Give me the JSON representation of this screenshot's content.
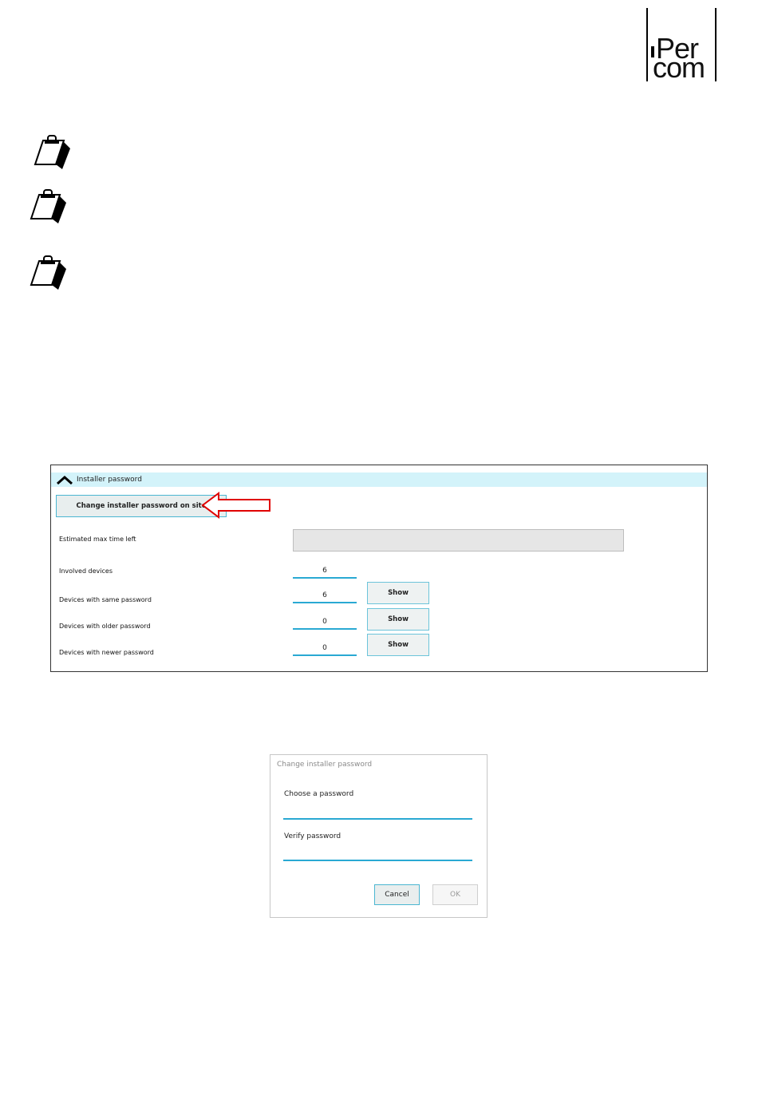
{
  "logo": {
    "line1": "Per",
    "line2": "com"
  },
  "panel": {
    "header_title": "Installer password",
    "change_button_label": "Change installer password on site",
    "rows": [
      {
        "label": "Estimated max time left"
      },
      {
        "label": "Involved devices",
        "value": "6"
      },
      {
        "label": "Devices with same password",
        "value": "6",
        "button": "Show"
      },
      {
        "label": "Devices with older password",
        "value": "0",
        "button": "Show"
      },
      {
        "label": "Devices with newer password",
        "value": "0",
        "button": "Show"
      }
    ],
    "highlight_color": "#d3f3fa",
    "accent_color": "#2aa9d3",
    "arrow_color": "#e00000"
  },
  "dialog": {
    "title": "Change installer password",
    "choose_label": "Choose a password",
    "verify_label": "Verify password",
    "cancel_label": "Cancel",
    "ok_label": "OK"
  },
  "icons": [
    "note-clipboard-icon",
    "note-clipboard-icon",
    "note-clipboard-icon",
    "chevron-up-icon",
    "red-arrow-icon"
  ]
}
